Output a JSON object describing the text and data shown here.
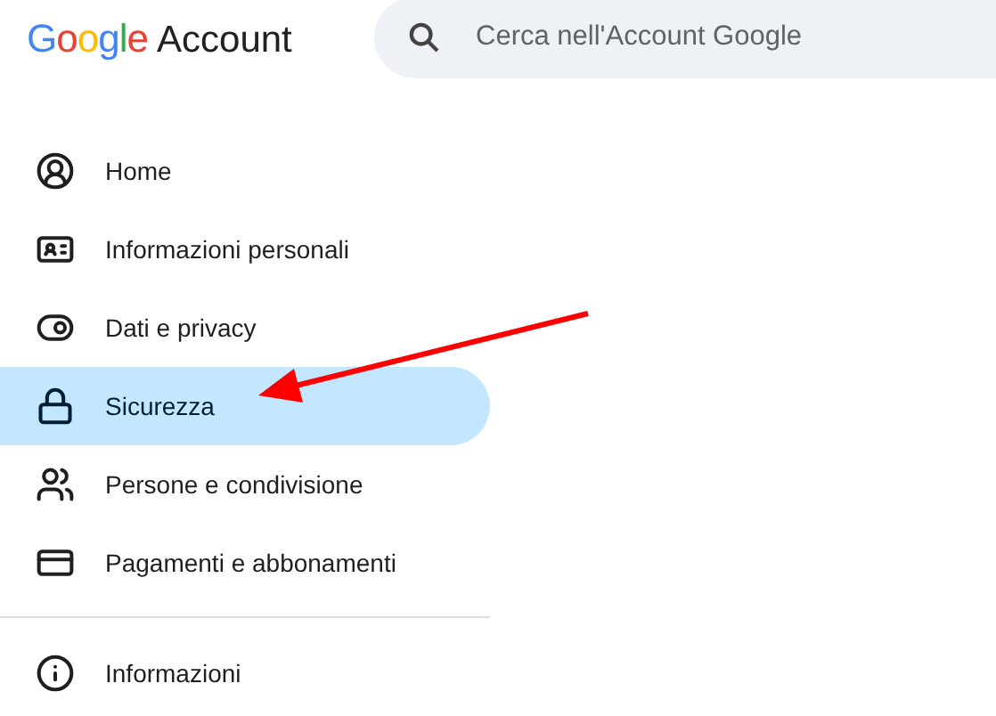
{
  "header": {
    "logo_brand": "Google",
    "logo_product": "Account",
    "search": {
      "placeholder": "Cerca nell'Account Google"
    }
  },
  "nav": {
    "items": [
      {
        "label": "Home",
        "selected": false
      },
      {
        "label": "Informazioni personali",
        "selected": false
      },
      {
        "label": "Dati e privacy",
        "selected": false
      },
      {
        "label": "Sicurezza",
        "selected": true
      },
      {
        "label": "Persone e condivisione",
        "selected": false
      },
      {
        "label": "Pagamenti e abbonamenti",
        "selected": false
      }
    ],
    "footer_items": [
      {
        "label": "Informazioni",
        "selected": false
      }
    ]
  }
}
